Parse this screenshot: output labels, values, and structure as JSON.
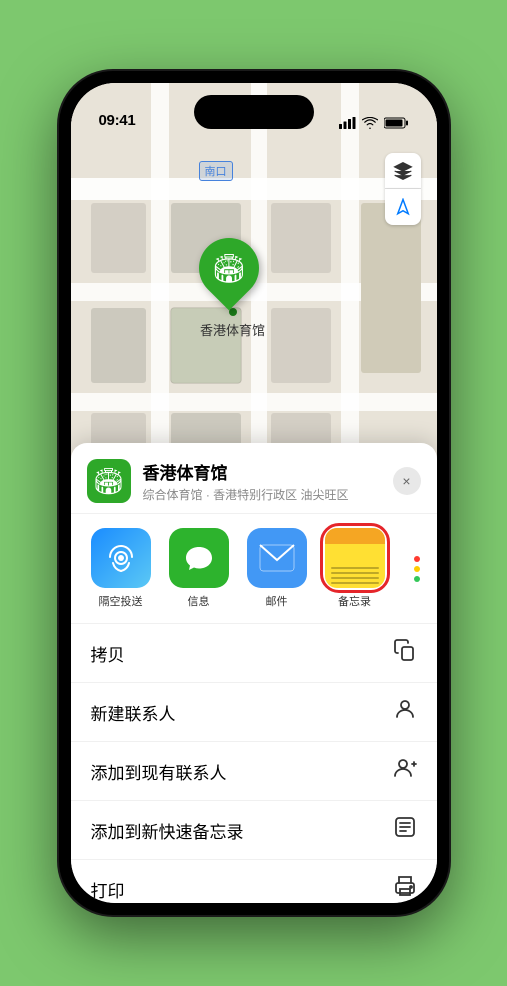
{
  "statusBar": {
    "time": "09:41",
    "locationArrow": true
  },
  "map": {
    "label": "南口",
    "markerLabel": "香港体育馆"
  },
  "sheet": {
    "venueName": "香港体育馆",
    "venueSubtitle": "综合体育馆 · 香港特别行政区 油尖旺区",
    "closeLabel": "×"
  },
  "shareApps": [
    {
      "id": "airdrop",
      "label": "隔空投送",
      "type": "airdrop"
    },
    {
      "id": "messages",
      "label": "信息",
      "type": "messages"
    },
    {
      "id": "mail",
      "label": "邮件",
      "type": "mail"
    },
    {
      "id": "notes",
      "label": "备忘录",
      "type": "notes",
      "selected": true
    }
  ],
  "menuItems": [
    {
      "id": "copy",
      "label": "拷贝",
      "icon": "copy"
    },
    {
      "id": "new-contact",
      "label": "新建联系人",
      "icon": "person"
    },
    {
      "id": "add-contact",
      "label": "添加到现有联系人",
      "icon": "person-add"
    },
    {
      "id": "quick-note",
      "label": "添加到新快速备忘录",
      "icon": "notes"
    },
    {
      "id": "print",
      "label": "打印",
      "icon": "printer"
    }
  ],
  "homeIndicator": true
}
